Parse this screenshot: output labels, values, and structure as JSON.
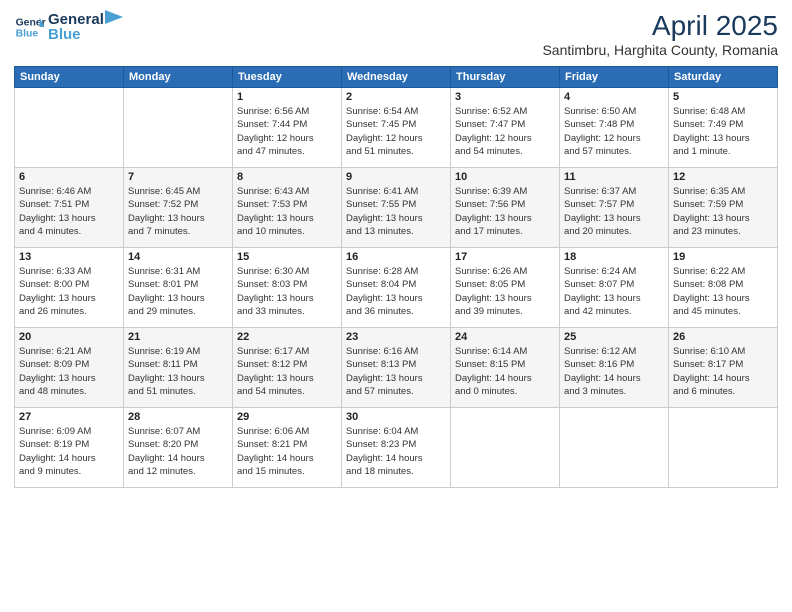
{
  "header": {
    "logo_line1": "General",
    "logo_line2": "Blue",
    "month_title": "April 2025",
    "subtitle": "Santimbru, Harghita County, Romania"
  },
  "weekdays": [
    "Sunday",
    "Monday",
    "Tuesday",
    "Wednesday",
    "Thursday",
    "Friday",
    "Saturday"
  ],
  "weeks": [
    [
      {
        "day": "",
        "info": ""
      },
      {
        "day": "",
        "info": ""
      },
      {
        "day": "1",
        "info": "Sunrise: 6:56 AM\nSunset: 7:44 PM\nDaylight: 12 hours\nand 47 minutes."
      },
      {
        "day": "2",
        "info": "Sunrise: 6:54 AM\nSunset: 7:45 PM\nDaylight: 12 hours\nand 51 minutes."
      },
      {
        "day": "3",
        "info": "Sunrise: 6:52 AM\nSunset: 7:47 PM\nDaylight: 12 hours\nand 54 minutes."
      },
      {
        "day": "4",
        "info": "Sunrise: 6:50 AM\nSunset: 7:48 PM\nDaylight: 12 hours\nand 57 minutes."
      },
      {
        "day": "5",
        "info": "Sunrise: 6:48 AM\nSunset: 7:49 PM\nDaylight: 13 hours\nand 1 minute."
      }
    ],
    [
      {
        "day": "6",
        "info": "Sunrise: 6:46 AM\nSunset: 7:51 PM\nDaylight: 13 hours\nand 4 minutes."
      },
      {
        "day": "7",
        "info": "Sunrise: 6:45 AM\nSunset: 7:52 PM\nDaylight: 13 hours\nand 7 minutes."
      },
      {
        "day": "8",
        "info": "Sunrise: 6:43 AM\nSunset: 7:53 PM\nDaylight: 13 hours\nand 10 minutes."
      },
      {
        "day": "9",
        "info": "Sunrise: 6:41 AM\nSunset: 7:55 PM\nDaylight: 13 hours\nand 13 minutes."
      },
      {
        "day": "10",
        "info": "Sunrise: 6:39 AM\nSunset: 7:56 PM\nDaylight: 13 hours\nand 17 minutes."
      },
      {
        "day": "11",
        "info": "Sunrise: 6:37 AM\nSunset: 7:57 PM\nDaylight: 13 hours\nand 20 minutes."
      },
      {
        "day": "12",
        "info": "Sunrise: 6:35 AM\nSunset: 7:59 PM\nDaylight: 13 hours\nand 23 minutes."
      }
    ],
    [
      {
        "day": "13",
        "info": "Sunrise: 6:33 AM\nSunset: 8:00 PM\nDaylight: 13 hours\nand 26 minutes."
      },
      {
        "day": "14",
        "info": "Sunrise: 6:31 AM\nSunset: 8:01 PM\nDaylight: 13 hours\nand 29 minutes."
      },
      {
        "day": "15",
        "info": "Sunrise: 6:30 AM\nSunset: 8:03 PM\nDaylight: 13 hours\nand 33 minutes."
      },
      {
        "day": "16",
        "info": "Sunrise: 6:28 AM\nSunset: 8:04 PM\nDaylight: 13 hours\nand 36 minutes."
      },
      {
        "day": "17",
        "info": "Sunrise: 6:26 AM\nSunset: 8:05 PM\nDaylight: 13 hours\nand 39 minutes."
      },
      {
        "day": "18",
        "info": "Sunrise: 6:24 AM\nSunset: 8:07 PM\nDaylight: 13 hours\nand 42 minutes."
      },
      {
        "day": "19",
        "info": "Sunrise: 6:22 AM\nSunset: 8:08 PM\nDaylight: 13 hours\nand 45 minutes."
      }
    ],
    [
      {
        "day": "20",
        "info": "Sunrise: 6:21 AM\nSunset: 8:09 PM\nDaylight: 13 hours\nand 48 minutes."
      },
      {
        "day": "21",
        "info": "Sunrise: 6:19 AM\nSunset: 8:11 PM\nDaylight: 13 hours\nand 51 minutes."
      },
      {
        "day": "22",
        "info": "Sunrise: 6:17 AM\nSunset: 8:12 PM\nDaylight: 13 hours\nand 54 minutes."
      },
      {
        "day": "23",
        "info": "Sunrise: 6:16 AM\nSunset: 8:13 PM\nDaylight: 13 hours\nand 57 minutes."
      },
      {
        "day": "24",
        "info": "Sunrise: 6:14 AM\nSunset: 8:15 PM\nDaylight: 14 hours\nand 0 minutes."
      },
      {
        "day": "25",
        "info": "Sunrise: 6:12 AM\nSunset: 8:16 PM\nDaylight: 14 hours\nand 3 minutes."
      },
      {
        "day": "26",
        "info": "Sunrise: 6:10 AM\nSunset: 8:17 PM\nDaylight: 14 hours\nand 6 minutes."
      }
    ],
    [
      {
        "day": "27",
        "info": "Sunrise: 6:09 AM\nSunset: 8:19 PM\nDaylight: 14 hours\nand 9 minutes."
      },
      {
        "day": "28",
        "info": "Sunrise: 6:07 AM\nSunset: 8:20 PM\nDaylight: 14 hours\nand 12 minutes."
      },
      {
        "day": "29",
        "info": "Sunrise: 6:06 AM\nSunset: 8:21 PM\nDaylight: 14 hours\nand 15 minutes."
      },
      {
        "day": "30",
        "info": "Sunrise: 6:04 AM\nSunset: 8:23 PM\nDaylight: 14 hours\nand 18 minutes."
      },
      {
        "day": "",
        "info": ""
      },
      {
        "day": "",
        "info": ""
      },
      {
        "day": "",
        "info": ""
      }
    ]
  ]
}
